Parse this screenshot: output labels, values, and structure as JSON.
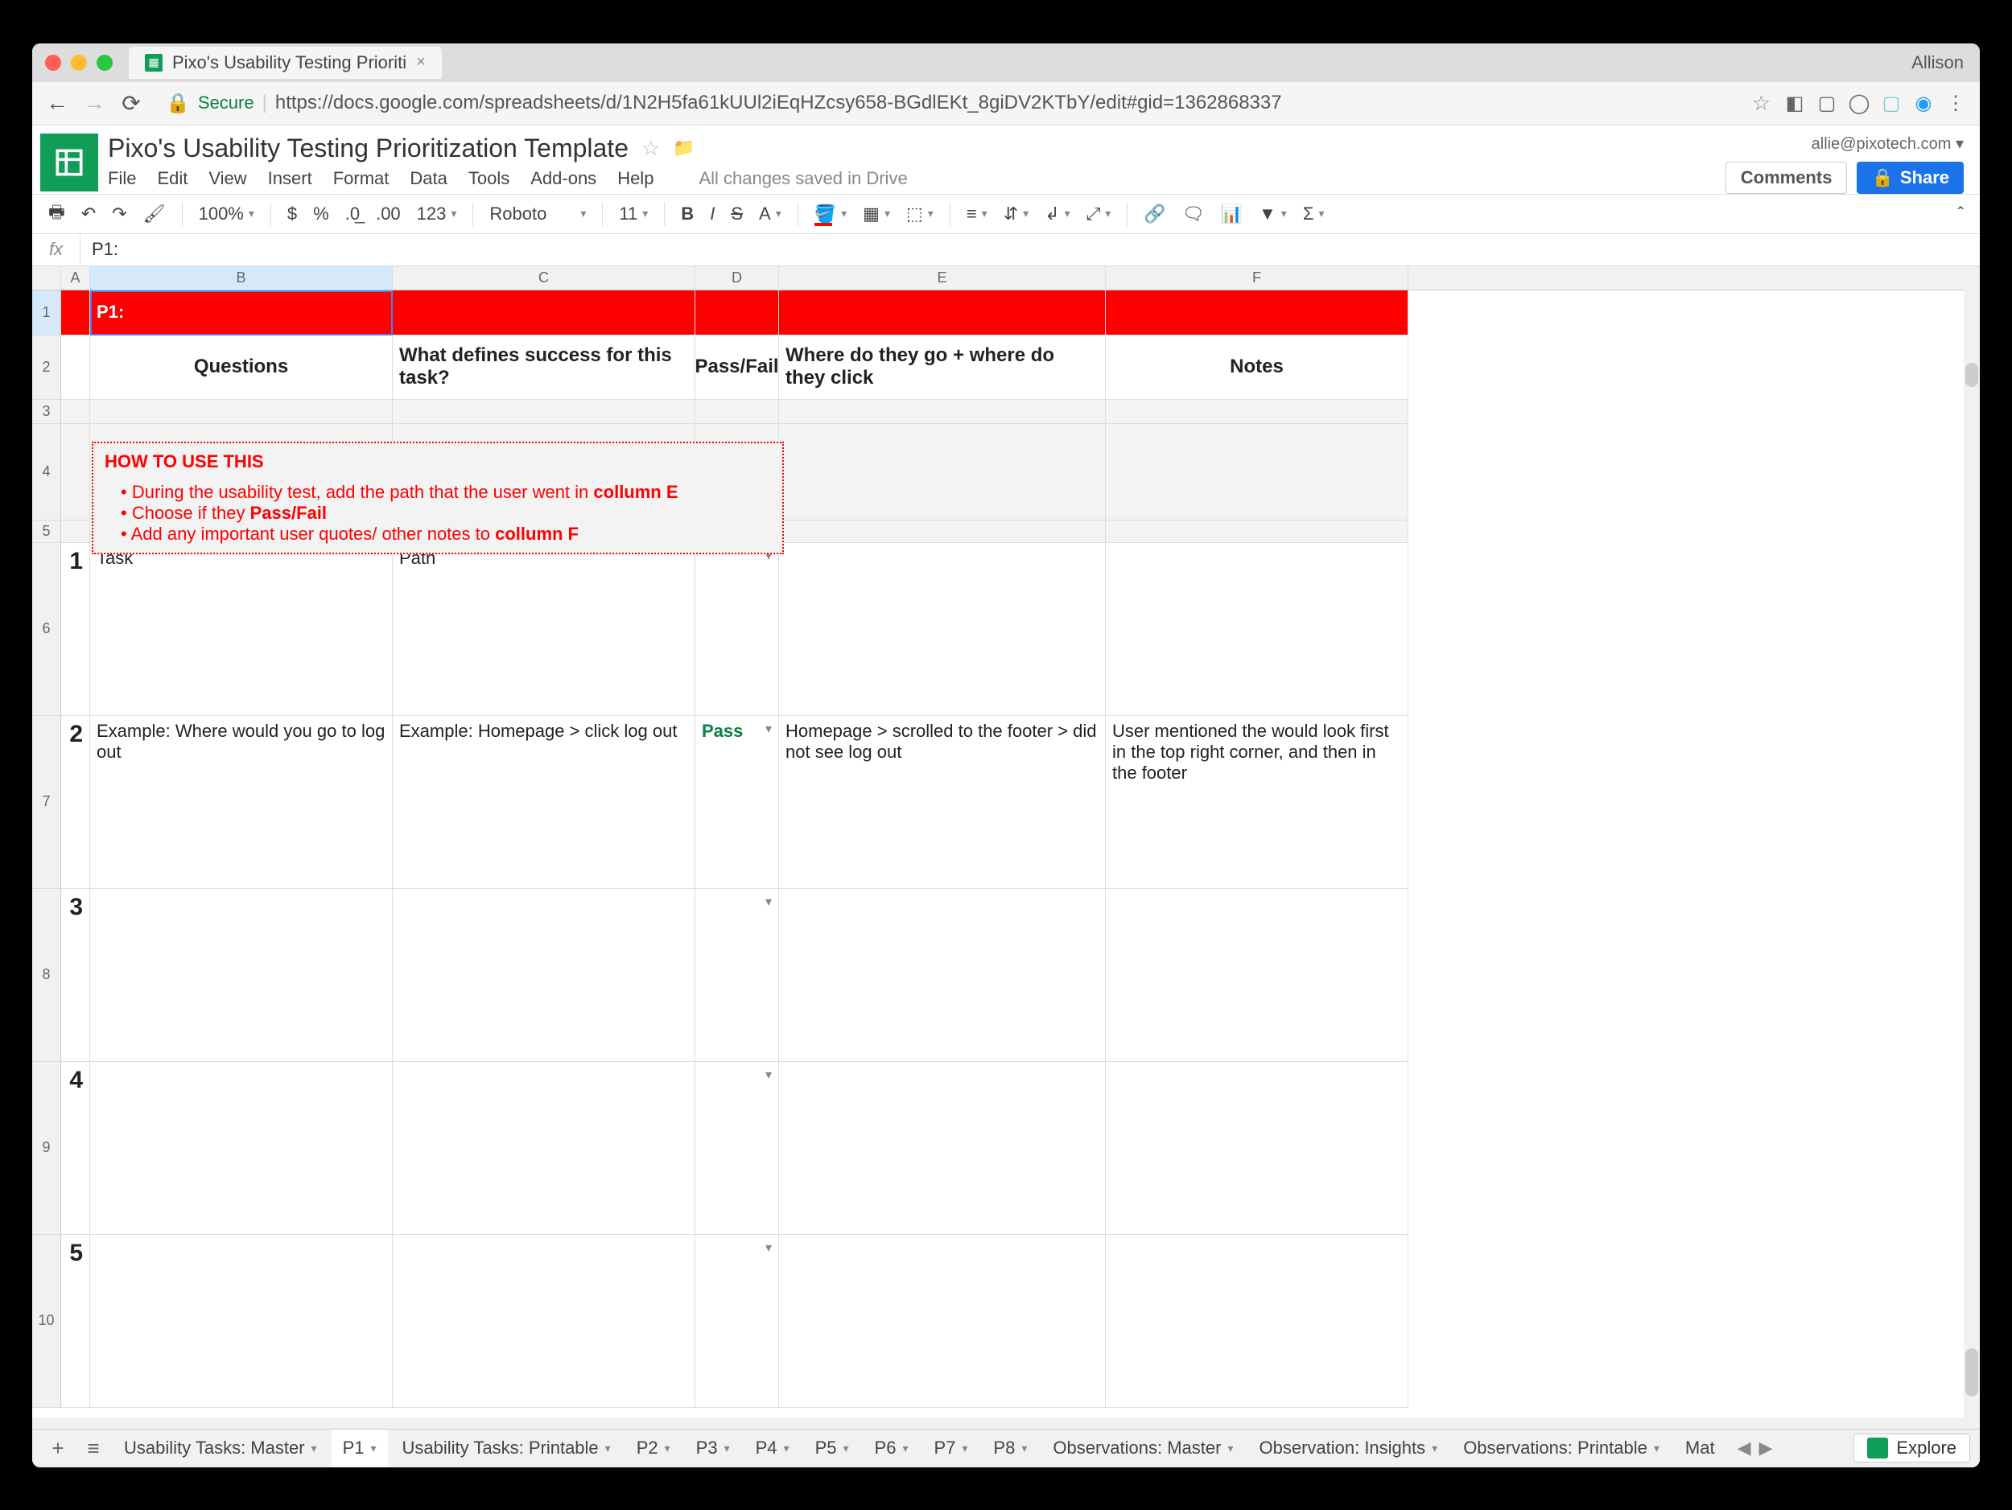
{
  "browser": {
    "tab_title": "Pixo's Usability Testing Prioriti",
    "profile": "Allison",
    "url_secure": "Secure",
    "url": "https://docs.google.com/spreadsheets/d/1N2H5fa61kUUl2iEqHZcsy658-BGdlEKt_8giDV2KTbY/edit#gid=1362868337"
  },
  "doc": {
    "title": "Pixo's Usability Testing Prioritization Template",
    "user_email": "allie@pixotech.com",
    "save_status": "All changes saved in Drive",
    "comments": "Comments",
    "share": "Share"
  },
  "menu": [
    "File",
    "Edit",
    "View",
    "Insert",
    "Format",
    "Data",
    "Tools",
    "Add-ons",
    "Help"
  ],
  "toolbar": {
    "zoom": "100%",
    "font": "Roboto",
    "size": "11",
    "format_btn": "123"
  },
  "formula": {
    "value": "P1:"
  },
  "columns": [
    "A",
    "B",
    "C",
    "D",
    "E",
    "F"
  ],
  "rownums": [
    "1",
    "2",
    "3",
    "4",
    "5",
    "6",
    "7",
    "8",
    "9",
    "10"
  ],
  "row1": {
    "A": "",
    "B": "P1:"
  },
  "headers": {
    "B": "Questions",
    "C": "What defines success for this task?",
    "D": "Pass/Fail",
    "E": "Where do they go + where do they click",
    "F": "Notes"
  },
  "howto": {
    "title": "HOW TO USE THIS",
    "line1a": "During the usability test, add the path that the user went in ",
    "line1b": "collumn E",
    "line2a": "Choose if they ",
    "line2b": "Pass/Fail",
    "line3a": "Add any important user quotes/ other notes to ",
    "line3b": "collumn F"
  },
  "tasks": [
    {
      "num": "1",
      "q": "Task",
      "succ": "Path",
      "pf": "",
      "path": "",
      "notes": ""
    },
    {
      "num": "2",
      "q": "Example: Where would you go to log out",
      "succ": "Example: Homepage > click log out",
      "pf": "Pass",
      "path": "Homepage > scrolled to the footer > did not see log out",
      "notes": "User mentioned the would look first in the top right corner, and then in the footer"
    },
    {
      "num": "3",
      "q": "",
      "succ": "",
      "pf": "",
      "path": "",
      "notes": ""
    },
    {
      "num": "4",
      "q": "",
      "succ": "",
      "pf": "",
      "path": "",
      "notes": ""
    },
    {
      "num": "5",
      "q": "",
      "succ": "",
      "pf": "",
      "path": "",
      "notes": ""
    }
  ],
  "sheets": [
    "Usability Tasks: Master",
    "P1",
    "Usability Tasks: Printable",
    "P2",
    "P3",
    "P4",
    "P5",
    "P6",
    "P7",
    "P8",
    "Observations: Master",
    "Observation: Insights",
    "Observations: Printable",
    "Mat"
  ],
  "active_sheet": "P1",
  "explore": "Explore"
}
